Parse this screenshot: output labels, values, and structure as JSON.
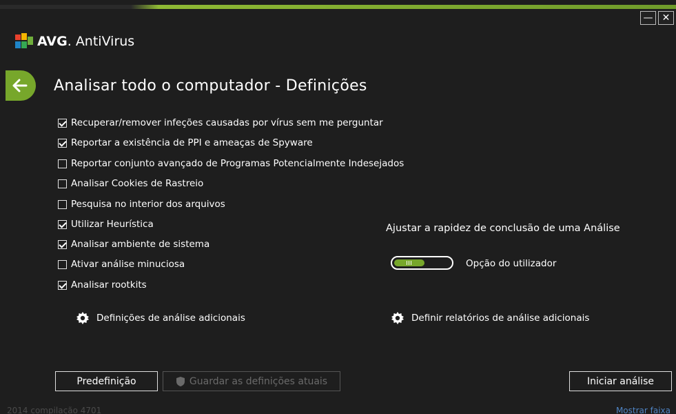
{
  "app": {
    "brand": "AVG",
    "product": "AntiVirus"
  },
  "window": {
    "minimize_label": "—",
    "close_label": "✕"
  },
  "page": {
    "title": "Analisar todo o computador - Definições",
    "back_icon": "arrow-left-icon"
  },
  "options": [
    {
      "label": "Recuperar/remover infeções causadas por vírus sem me perguntar",
      "checked": true
    },
    {
      "label": "Reportar a existência de PPI e ameaças de Spyware",
      "checked": true
    },
    {
      "label": "Reportar conjunto avançado de Programas Potencialmente Indesejados",
      "checked": false
    },
    {
      "label": "Analisar Cookies de Rastreio",
      "checked": false
    },
    {
      "label": "Pesquisa no interior dos arquivos",
      "checked": false
    },
    {
      "label": "Utilizar Heurística",
      "checked": true
    },
    {
      "label": "Analisar ambiente de sistema",
      "checked": true
    },
    {
      "label": "Ativar análise minuciosa",
      "checked": false
    },
    {
      "label": "Analisar rootkits",
      "checked": true
    }
  ],
  "speed": {
    "title": "Ajustar a rapidez de conclusão de uma Análise",
    "value_label": "Opção do utilizador"
  },
  "links": {
    "additional_settings": "Definições de análise adicionais",
    "additional_reports": "Definir relatórios de análise adicionais"
  },
  "buttons": {
    "defaults": "Predefinição",
    "save": "Guardar as definições atuais",
    "start": "Iniciar análise"
  },
  "footer": {
    "build": "2014  compilação 4701",
    "show_bar": "Mostrar faixa"
  },
  "colors": {
    "accent": "#77a72b",
    "background": "#1e1e1e",
    "link": "#4f84c4"
  }
}
